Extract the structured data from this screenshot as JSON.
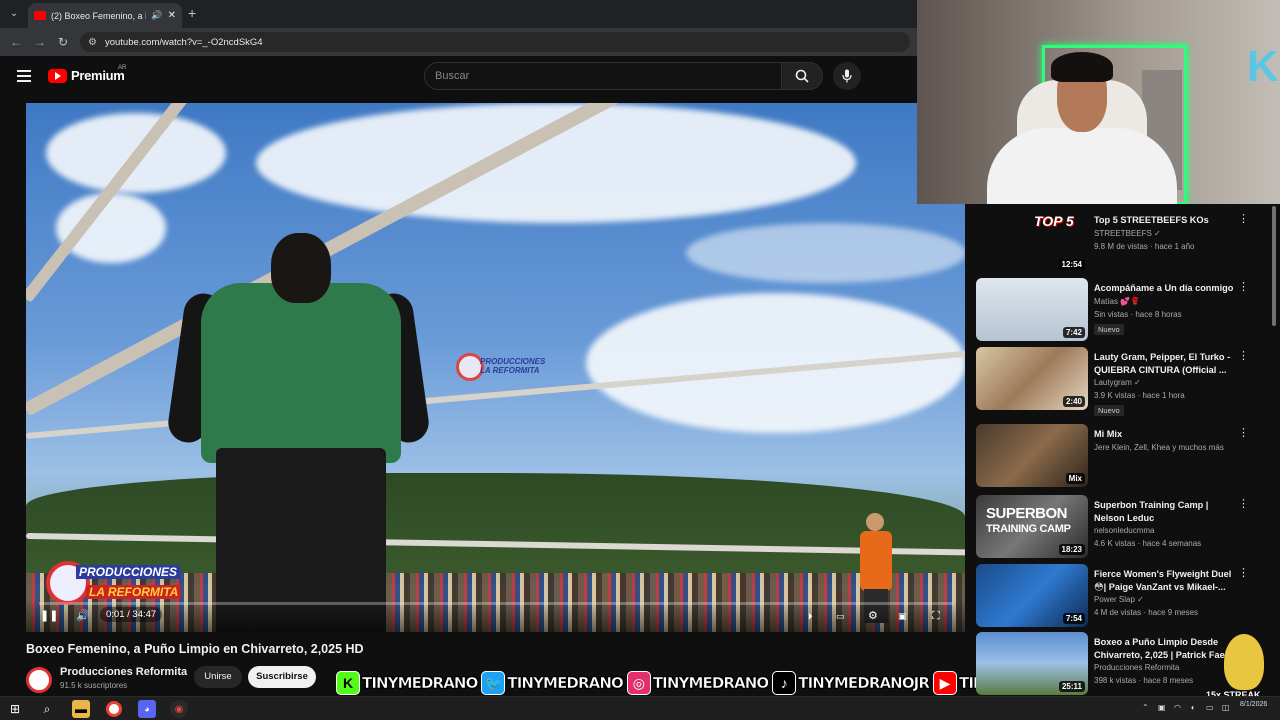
{
  "browser": {
    "tab_title": "(2) Boxeo Femenino, a Puño Limpio",
    "url": "youtube.com/watch?v=_-O2ncdSkG4",
    "new_tab_icon": "plus-icon"
  },
  "youtube": {
    "logo_text": "Premium",
    "country_code": "AR",
    "search_placeholder": "Buscar"
  },
  "player": {
    "current_time": "0:01",
    "duration": "34:47",
    "time_display": "0:01 / 34:47",
    "progress_fraction": 0.0005,
    "watermark_line1": "PRODUCCIONES",
    "watermark_line2": "LA REFORMITA"
  },
  "video": {
    "title": "Boxeo Femenino, a Puño Limpio en Chivarreto, 2,025 HD",
    "channel": "Producciones  Reformita",
    "subscribers": "91.5 k suscriptores",
    "join_label": "Unirse",
    "subscribe_label": "Suscribirse"
  },
  "social": [
    {
      "icon": "K",
      "handle": "TINYMEDRANO",
      "color": "#53fc18",
      "text_color": "#000"
    },
    {
      "icon": "🐦",
      "handle": "TINYMEDRANO",
      "color": "#1da1f2",
      "text_color": "#fff"
    },
    {
      "icon": "◎",
      "handle": "TINYMEDRANO",
      "color": "#e1306c",
      "text_color": "#fff"
    },
    {
      "icon": "♪",
      "handle": "TINYMEDRANOJR",
      "color": "#000000",
      "text_color": "#fff"
    },
    {
      "icon": "▶",
      "handle": "TINYMEDRANO",
      "color": "#ff0000",
      "text_color": "#fff"
    }
  ],
  "recommendations": [
    {
      "title": "Top 5 STREETBEEFS KOs",
      "channel": "STREETBEEFS",
      "verified": true,
      "meta": "9.8 M de vistas · hace 1 año",
      "duration": "12:54",
      "badge": "",
      "thumb": "linear-gradient(135deg,#6c8a3e,#b59b5a 50,#3e5a2a)"
    },
    {
      "title": "Acompáñame a Un día conmigo",
      "channel": "Matías 💕🌹",
      "verified": false,
      "meta": "Sin vistas · hace 8 horas",
      "duration": "7:42",
      "badge": "Nuevo",
      "thumb": "linear-gradient(180deg,#dfe6ee,#b6c4d2)"
    },
    {
      "title": "Lauty Gram, Peipper, El Turko - QUIEBRA CINTURA (Official ...",
      "channel": "Lautygram",
      "verified": true,
      "meta": "3.9 K vistas · hace 1 hora",
      "duration": "2:40",
      "badge": "Nuevo",
      "thumb": "linear-gradient(135deg,#d9c6a4,#9c7a5a,#e6d8c0)"
    },
    {
      "title": "Mi Mix",
      "channel": "Jere Klein, Zell, Khea y muchos más",
      "verified": false,
      "meta": "",
      "duration": "Mix",
      "badge": "",
      "thumb": "linear-gradient(135deg,#4a3a2e,#8a6a4a,#2e241c)"
    },
    {
      "title": "Superbon Training Camp | Nelson Leduc",
      "channel": "nelsonleducmma",
      "verified": false,
      "meta": "4.6 K vistas · hace 4 semanas",
      "duration": "18:23",
      "badge": "",
      "thumb": "linear-gradient(135deg,#3a3a3a,#777,#2a2a2a)"
    },
    {
      "title": "Fierce Women's Flyweight Duel 😳| Paige VanZant vs Mikael-...",
      "channel": "Power Slap",
      "verified": true,
      "meta": "4 M de vistas · hace 9 meses",
      "duration": "7:54",
      "badge": "",
      "thumb": "linear-gradient(135deg,#1b4a8a,#2f7ad0,#0f2a55)"
    },
    {
      "title": "Boxeo a Puño Limpio Desde Chivarreto, 2,025 | Patrick Fae...",
      "channel": "Producciones Reformita",
      "verified": false,
      "meta": "398 k vistas · hace 8 meses",
      "duration": "25:11",
      "badge": "",
      "thumb": "linear-gradient(180deg,#5d8fd1,#9cc0e6 50%,#5a7a40)"
    }
  ],
  "thumb_texts": {
    "streetbeefs": "TOP 5",
    "superbon_line1": "SUPERBON",
    "superbon_line2": "TRAINING CAMP"
  },
  "streak": {
    "label": "15x STREAK"
  },
  "taskbar": {
    "clock_time": "8/1/2026",
    "clock_label": "8/1/2026"
  }
}
